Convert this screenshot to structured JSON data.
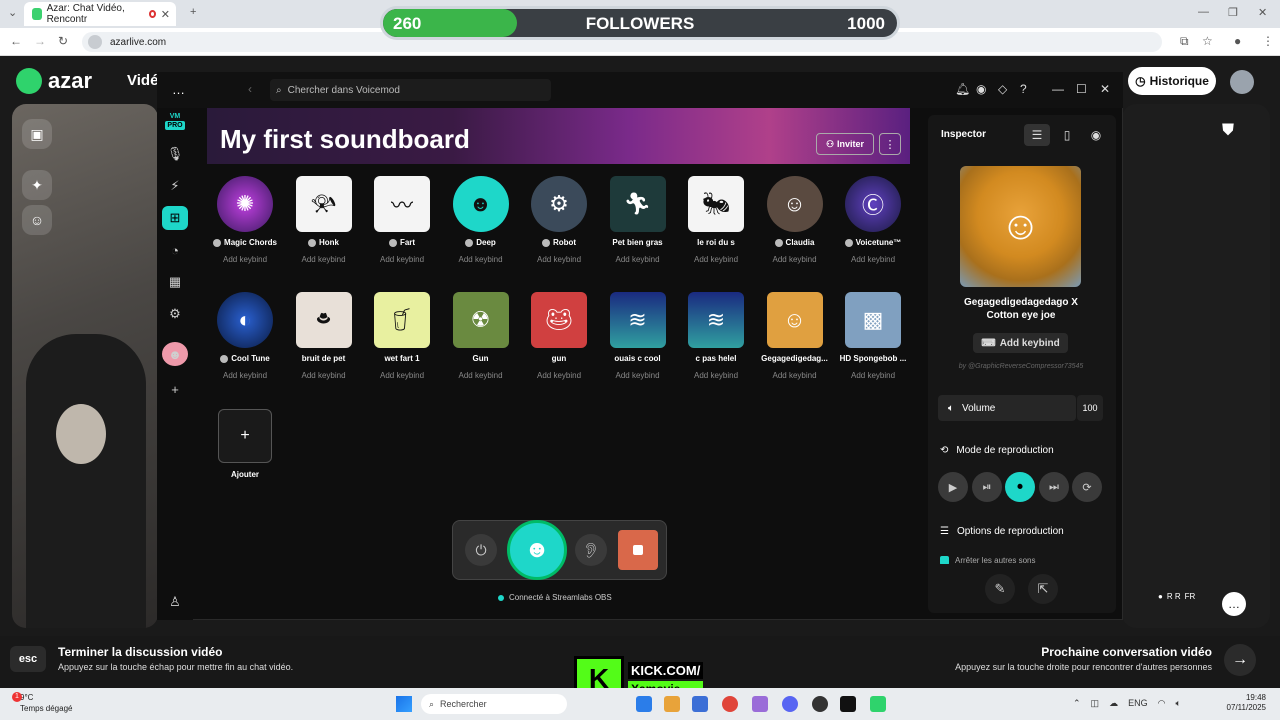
{
  "browser": {
    "tab_title": "Azar: Chat Vidéo, Rencontr",
    "tab_close": "✕",
    "new_tab": "+",
    "url": "azarlive.com",
    "window_controls": [
      "—",
      "❐",
      "✕"
    ]
  },
  "followers": {
    "current": "260",
    "title": "FOLLOWERS",
    "goal": "1000",
    "progress": 0.26
  },
  "azar": {
    "logo": "azar",
    "nav_label": "Vidé",
    "history_button": "Historique",
    "end_title": "Terminer la discussion vidéo",
    "end_sub": "Appuyez sur la touche échap pour mettre fin au chat vidéo.",
    "esc_key": "esc",
    "next_title": "Prochaine conversation vidéo",
    "next_sub": "Appuyez sur la touche droite pour rencontrer d'autres personnes",
    "partner_initials": "R R",
    "partner_country": "FR"
  },
  "kick": {
    "line1": "KICK.COM/",
    "line2": "Xamovie"
  },
  "voicemod": {
    "search_placeholder": "Chercher dans Voicemod",
    "logo_pro": "PRO",
    "soundboard_title": "My first soundboard",
    "invite_label": "Inviter",
    "add_label": "Ajouter",
    "obs_status": "Connecté à Streamlabs OBS",
    "sounds_row1": [
      {
        "name": "Magic Chords",
        "keybind": "Add keybind",
        "icon": "magic-chords-icon",
        "voice": true
      },
      {
        "name": "Honk",
        "keybind": "Add keybind",
        "icon": "horn-icon",
        "voice": true
      },
      {
        "name": "Fart",
        "keybind": "Add keybind",
        "icon": "fart-icon",
        "voice": true
      },
      {
        "name": "Deep",
        "keybind": "Add keybind",
        "icon": "deep-icon",
        "voice": true
      },
      {
        "name": "Robot",
        "keybind": "Add keybind",
        "icon": "robot-icon",
        "voice": true
      },
      {
        "name": "Pet bien gras",
        "keybind": "Add keybind",
        "icon": "running-man-icon",
        "voice": false
      },
      {
        "name": "le roi du s",
        "keybind": "Add keybind",
        "icon": "ant-icon",
        "voice": false
      },
      {
        "name": "Claudia",
        "keybind": "Add keybind",
        "icon": "claudia-icon",
        "voice": true
      },
      {
        "name": "Voicetune™",
        "keybind": "Add keybind",
        "icon": "voicetune-icon",
        "voice": true
      }
    ],
    "sounds_row2": [
      {
        "name": "Cool Tune",
        "keybind": "Add keybind",
        "icon": "cool-tune-icon",
        "voice": true
      },
      {
        "name": "bruit de pet",
        "keybind": "Add keybind",
        "icon": "hat-man-icon",
        "voice": false
      },
      {
        "name": "wet fart 1",
        "keybind": "Add keybind",
        "icon": "drink-icon",
        "voice": false
      },
      {
        "name": "Gun",
        "keybind": "Add keybind",
        "icon": "gir-icon",
        "voice": false
      },
      {
        "name": "gun",
        "keybind": "Add keybind",
        "icon": "frog-icon",
        "voice": false
      },
      {
        "name": "ouais c cool",
        "keybind": "Add keybind",
        "icon": "wave-icon",
        "voice": false
      },
      {
        "name": "c pas helel",
        "keybind": "Add keybind",
        "icon": "wave-icon",
        "voice": false
      },
      {
        "name": "Gegagedigedag...",
        "keybind": "Add keybind",
        "icon": "nugget-icon",
        "voice": false
      },
      {
        "name": "HD Spongebob ...",
        "keybind": "Add keybind",
        "icon": "spongebob-icon",
        "voice": false
      }
    ],
    "inspector": {
      "title": "Inspector",
      "sound_name_line1": "Gegagedigedagedago X",
      "sound_name_line2": "Cotton eye joe",
      "add_keybind": "Add keybind",
      "byline": "by @GraphicReverseCompressor73545",
      "volume_label": "Volume",
      "volume_value": "100",
      "mode_label": "Mode de reproduction",
      "options_label": "Options de reproduction",
      "cut_label": "Arrêter les autres sons"
    }
  },
  "taskbar": {
    "temp": "9°C",
    "weather": "Temps dégagé",
    "search": "Rechercher",
    "lang": "ENG",
    "time": "19:48",
    "date": "07/11/2025",
    "notif_count": "1"
  }
}
